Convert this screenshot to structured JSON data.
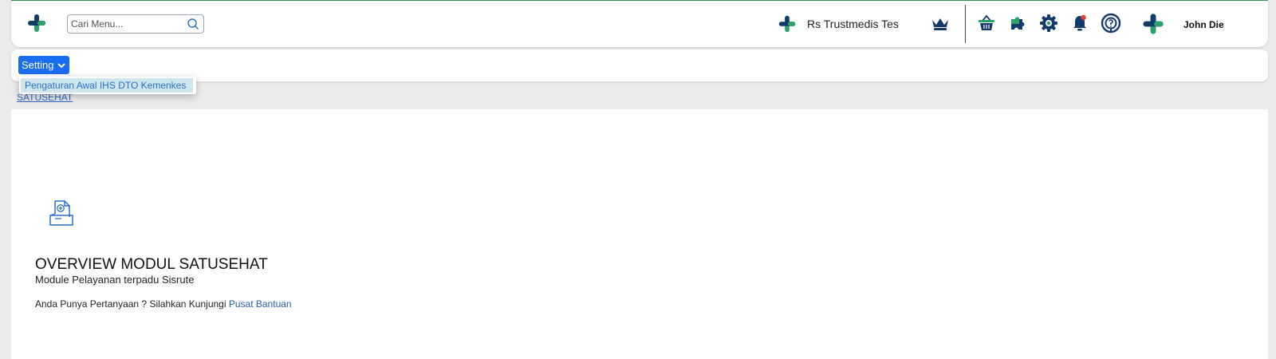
{
  "header": {
    "search_placeholder": "Cari Menu...",
    "hospital_name": "Rs Trustmedis Tes",
    "username": "John Die",
    "icons": [
      "premium-crown-icon",
      "shopping-basket-icon",
      "puzzle-icon",
      "settings-gear-icon",
      "notification-bell-icon",
      "help-support-icon"
    ]
  },
  "menubar": {
    "setting_label": "Setting",
    "dropdown_items": [
      "Pengaturan Awal IHS DTO Kemenkes"
    ]
  },
  "breadcrumb": "SATUSEHAT",
  "overview": {
    "title": "OVERVIEW MODUL SATUSEHAT",
    "subtitle": "Module Pelayanan terpadu Sisrute",
    "help_text": "Anda Punya Pertanyaan ? Silahkan Kunjungi",
    "help_link": "Pusat Bantuan"
  },
  "colors": {
    "brand_green": "#2aa36b",
    "brand_navy": "#123a6b",
    "primary_blue": "#1a6cf0",
    "notification_red": "#e53935"
  }
}
